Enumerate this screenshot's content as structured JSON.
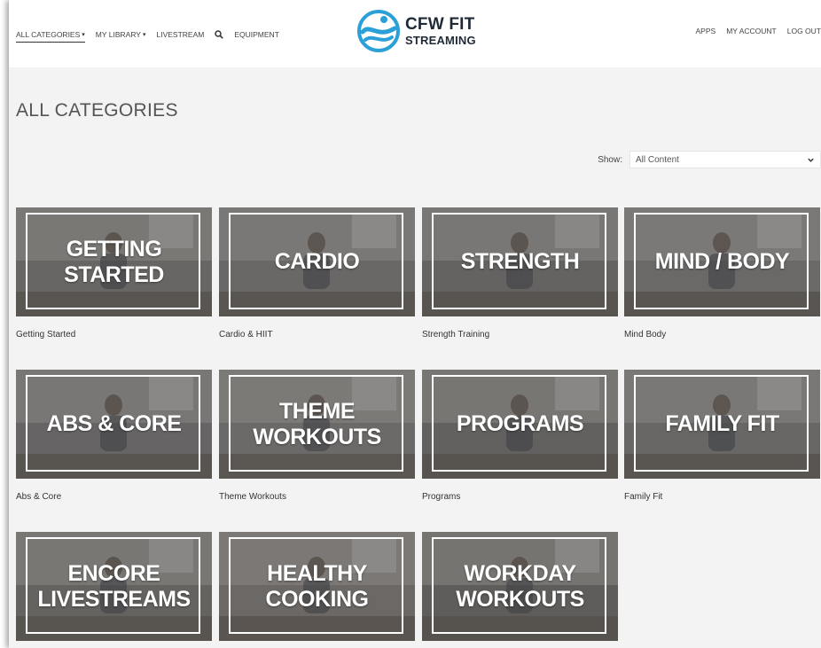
{
  "header": {
    "nav_left": [
      {
        "label": "ALL CATEGORIES",
        "dropdown": true,
        "active": true
      },
      {
        "label": "MY LIBRARY",
        "dropdown": true,
        "active": false
      },
      {
        "label": "LIVESTREAM",
        "dropdown": false,
        "active": false
      }
    ],
    "search_icon": "search-icon",
    "equipment_label": "EQUIPMENT",
    "logo": {
      "line1": "CFW FIT",
      "line2": "STREAMING"
    },
    "nav_right": [
      {
        "label": "APPS"
      },
      {
        "label": "MY ACCOUNT"
      },
      {
        "label": "LOG OUT"
      }
    ]
  },
  "page": {
    "title": "ALL CATEGORIES",
    "show_label": "Show:",
    "show_value": "All Content"
  },
  "colors": {
    "logo_blue": "#2a9fd8",
    "background": "#f3f3f3",
    "text_dark": "#333333"
  },
  "categories": [
    {
      "tile": "GETTING STARTED",
      "label": "Getting Started"
    },
    {
      "tile": "CARDIO",
      "label": "Cardio & HIIT"
    },
    {
      "tile": "STRENGTH",
      "label": "Strength Training"
    },
    {
      "tile": "MIND / BODY",
      "label": "Mind Body"
    },
    {
      "tile": "ABS & CORE",
      "label": "Abs & Core"
    },
    {
      "tile": "THEME WORKOUTS",
      "label": "Theme Workouts"
    },
    {
      "tile": "PROGRAMS",
      "label": "Programs"
    },
    {
      "tile": "FAMILY FIT",
      "label": "Family Fit"
    },
    {
      "tile": "ENCORE\nLIVESTREAMS",
      "label": ""
    },
    {
      "tile": "HEALTHY COOKING",
      "label": ""
    },
    {
      "tile": "WORKDAY\nWORKOUTS",
      "label": ""
    }
  ]
}
